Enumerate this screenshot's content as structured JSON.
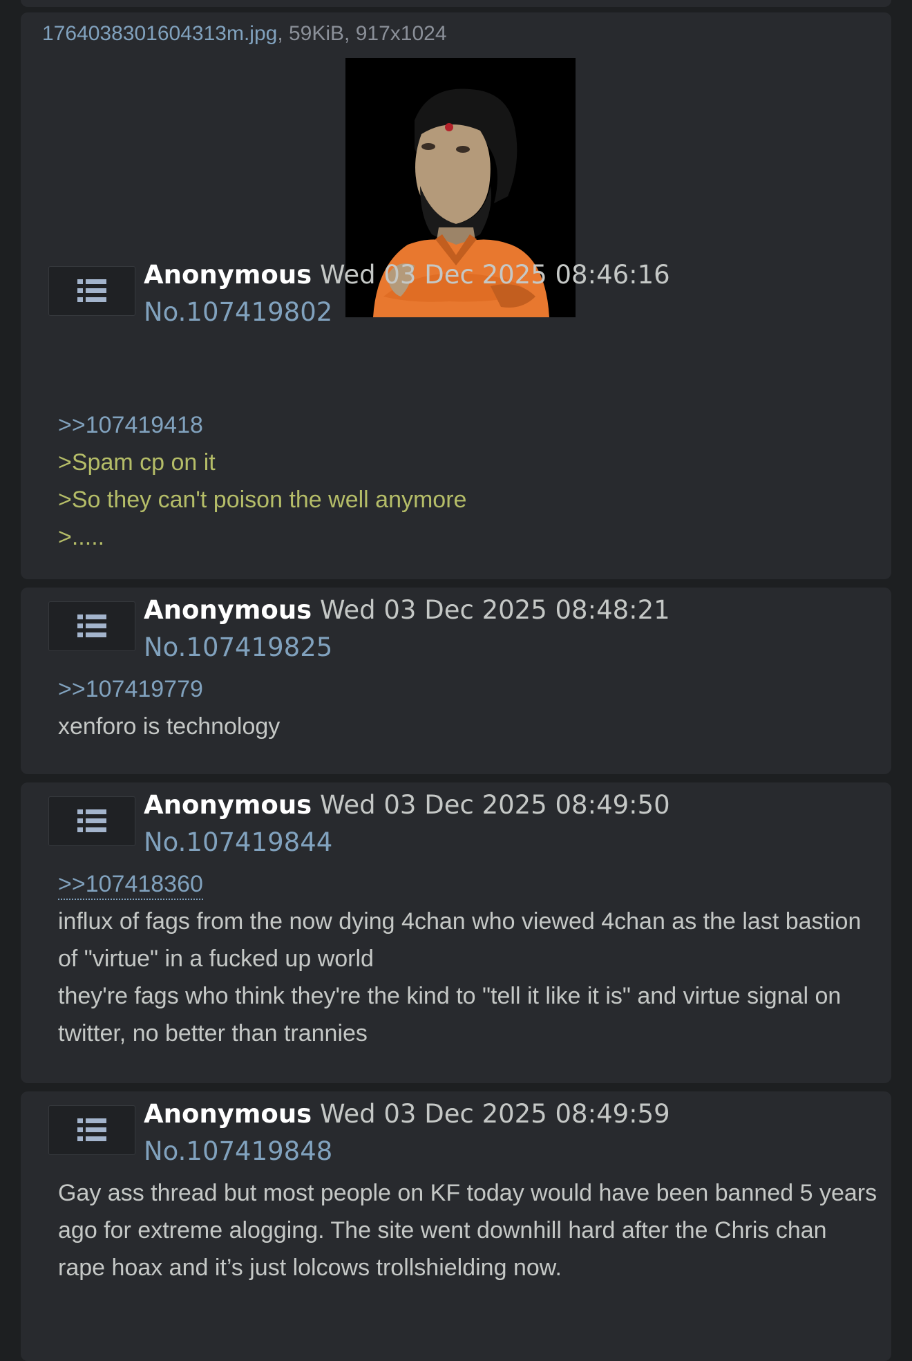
{
  "posts": [
    {
      "file": {
        "name": "1764038301604313m.jpg",
        "meta": ", 59KiB, 917x1024",
        "thumbnail_icon": "cartoon-man-orange-shirt-image"
      },
      "name": "Anonymous",
      "date": "Wed 03 Dec 2025 08:46:16",
      "number": "No.107419802",
      "lines": [
        {
          "type": "quotelink",
          "text": ">>107419418"
        },
        {
          "type": "greentext",
          "text": ">Spam cp on it"
        },
        {
          "type": "greentext",
          "text": ">So they can't poison the well anymore"
        },
        {
          "type": "greentext",
          "text": ">....."
        }
      ]
    },
    {
      "name": "Anonymous",
      "date": "Wed 03 Dec 2025 08:48:21",
      "number": "No.107419825",
      "lines": [
        {
          "type": "quotelink",
          "text": ">>107419779"
        },
        {
          "type": "text",
          "text": "xenforo is technology"
        }
      ]
    },
    {
      "name": "Anonymous",
      "date": "Wed 03 Dec 2025 08:49:50",
      "number": "No.107419844",
      "lines": [
        {
          "type": "quotelink",
          "text": ">>107418360"
        },
        {
          "type": "text",
          "text": "influx of fags from the now dying 4chan who viewed 4chan as the last bastion of \"virtue\" in a fucked up world"
        },
        {
          "type": "text",
          "text": "they're fags who think they're the kind to \"tell it like it is\" and virtue signal on twitter, no better than trannies"
        }
      ]
    },
    {
      "name": "Anonymous",
      "date": "Wed 03 Dec 2025 08:49:59",
      "number": "No.107419848",
      "lines": [
        {
          "type": "text",
          "text": "Gay ass thread but most people on KF today would have been banned 5 years ago for extreme alogging. The site went downhill hard after the Chris chan rape hoax and it’s just lolcows trollshielding now."
        }
      ]
    }
  ],
  "menu_icon": "list-menu-icon",
  "colors": {
    "background": "#1d1f21",
    "post_bg": "#282a2e",
    "link": "#81a2be",
    "greentext": "#b5bd68",
    "text": "#c5c8c6",
    "name": "#ffffff"
  }
}
